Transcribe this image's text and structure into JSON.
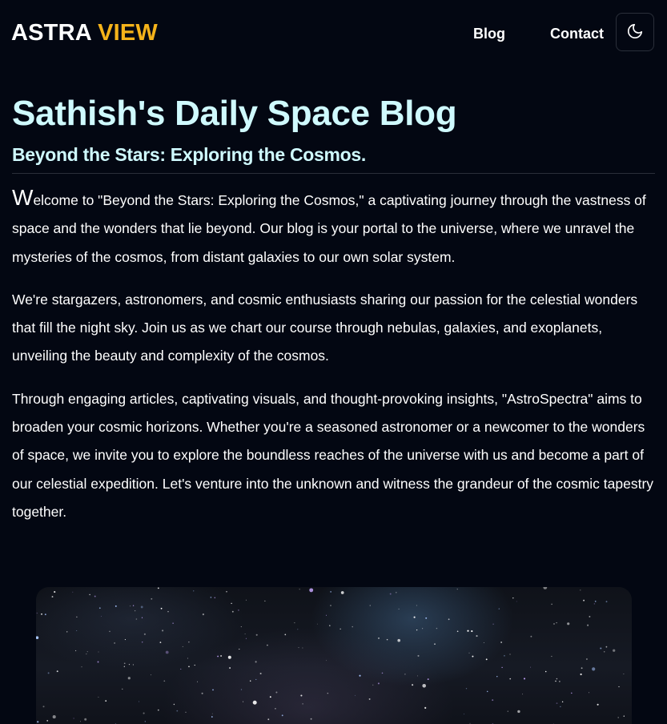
{
  "header": {
    "logo_primary": "ASTRA",
    "logo_accent": "VIEW",
    "nav": {
      "blog": "Blog",
      "contact": "Contact"
    },
    "theme_toggle_icon": "moon-icon"
  },
  "main": {
    "title": "Sathish's Daily Space Blog",
    "subtitle": "Beyond the Stars: Exploring the Cosmos.",
    "intro_dropcap": "W",
    "intro_rest": "elcome to \"Beyond the Stars: Exploring the Cosmos,\" a captivating journey through the vastness of space and the wonders that lie beyond. Our blog is your portal to the universe, where we unravel the mysteries of the cosmos, from distant galaxies to our own solar system.",
    "paragraph_2": "We're stargazers, astronomers, and cosmic enthusiasts sharing our passion for the celestial wonders that fill the night sky. Join us as we chart our course through nebulas, galaxies, and exoplanets, unveiling the beauty and complexity of the cosmos.",
    "paragraph_3": "Through engaging articles, captivating visuals, and thought-provoking insights, \"AstroSpectra\" aims to broaden your cosmic horizons. Whether you're a seasoned astronomer or a newcomer to the wonders of space, we invite you to explore the boundless reaches of the universe with us and become a part of our celestial expedition. Let's venture into the unknown and witness the grandeur of the cosmic tapestry together."
  },
  "colors": {
    "background": "#030712",
    "accent": "#f5b31a",
    "heading": "#cffafe",
    "text": "#ffffff",
    "border": "#2a2f3a"
  }
}
